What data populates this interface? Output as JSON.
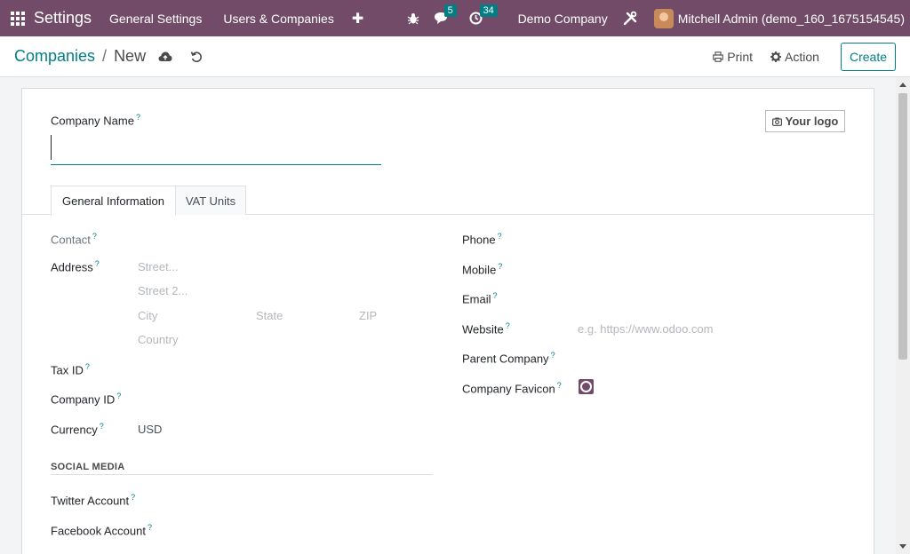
{
  "navbar": {
    "brand": "Settings",
    "menu": [
      "General Settings",
      "Users & Companies"
    ],
    "plus": "✚",
    "messages_badge": "5",
    "activities_badge": "34",
    "company": "Demo Company",
    "user": "Mitchell Admin (demo_160_1675154545)"
  },
  "control": {
    "breadcrumb_parent": "Companies",
    "breadcrumb_sep": "/",
    "breadcrumb_current": "New",
    "print_label": "Print",
    "action_label": "Action",
    "create_label": "Create"
  },
  "form": {
    "company_name_label": "Company Name",
    "logo_button": "Your logo",
    "help_mark": "?",
    "tabs": [
      "General Information",
      "VAT Units"
    ],
    "left": {
      "contact": "Contact",
      "address": "Address",
      "street_ph": "Street...",
      "street2_ph": "Street 2...",
      "city_ph": "City",
      "state_ph": "State",
      "zip_ph": "ZIP",
      "country_ph": "Country",
      "tax_id": "Tax ID",
      "company_id": "Company ID",
      "currency": "Currency",
      "currency_value": "USD"
    },
    "right": {
      "phone": "Phone",
      "mobile": "Mobile",
      "email": "Email",
      "website": "Website",
      "website_ph": "e.g. https://www.odoo.com",
      "parent_company": "Parent Company",
      "company_favicon": "Company Favicon"
    },
    "social_title": "SOCIAL MEDIA",
    "twitter": "Twitter Account",
    "facebook": "Facebook Account"
  },
  "colors": {
    "navbar": "#714b67",
    "accent": "#017e84"
  }
}
